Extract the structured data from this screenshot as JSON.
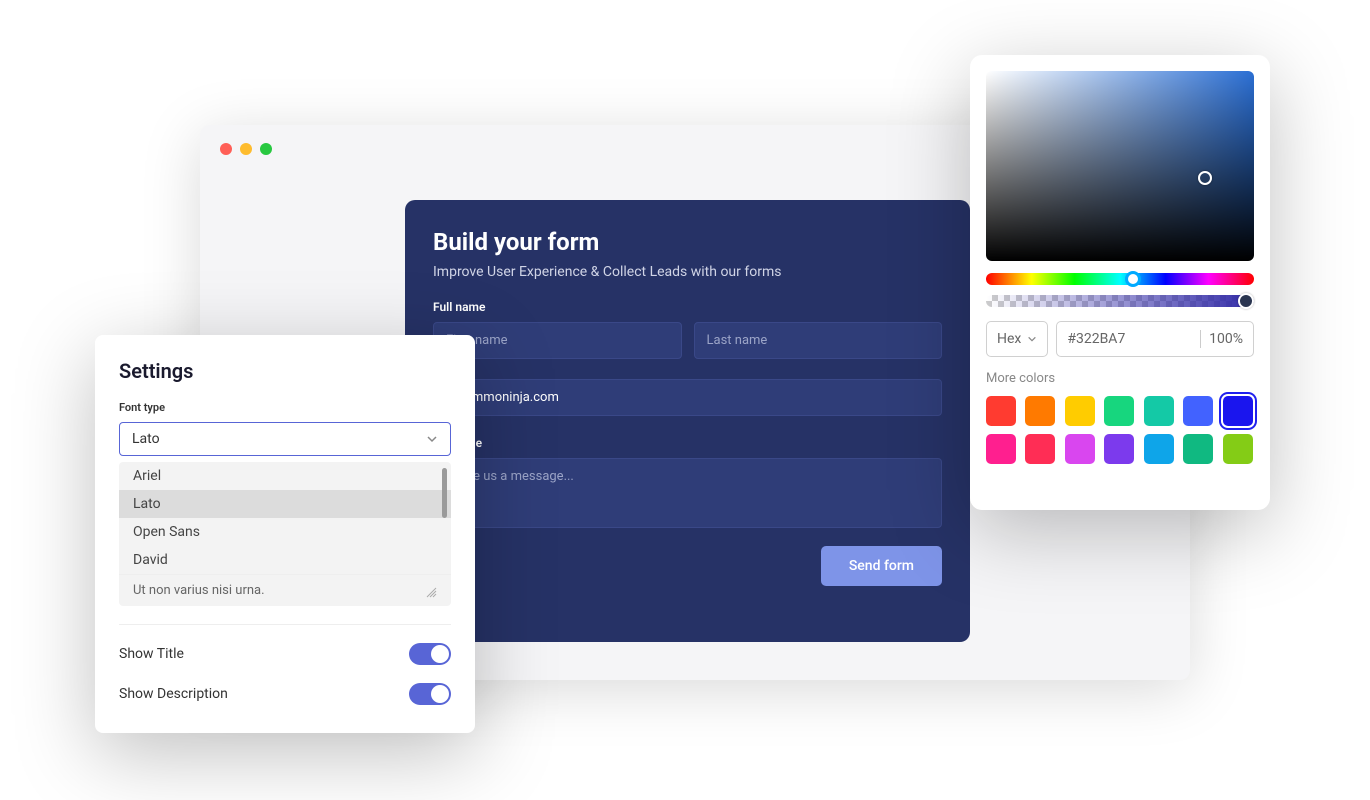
{
  "form": {
    "title": "Build your form",
    "subtitle": "Improve User Experience & Collect Leads with our forms",
    "fullname_label": "Full name",
    "firstname_placeholder": "First name",
    "lastname_placeholder": "Last name",
    "email_value": "@commoninja.com",
    "message_label": "Message",
    "message_placeholder": "Leave us a message...",
    "submit_label": "Send form"
  },
  "settings": {
    "title": "Settings",
    "font_type_label": "Font type",
    "font_selected": "Lato",
    "font_options": [
      "Ariel",
      "Lato",
      "Open Sans",
      "David"
    ],
    "lorem_text": "Ut non varius nisi urna.",
    "show_title_label": "Show Title",
    "show_description_label": "Show Description",
    "show_title_on": true,
    "show_description_on": true
  },
  "color_picker": {
    "format_label": "Hex",
    "hex_value": "#322BA7",
    "opacity": "100%",
    "more_colors_label": "More colors",
    "swatches": [
      "#ff3b30",
      "#ff7a00",
      "#ffcc00",
      "#17d67e",
      "#14c9a6",
      "#4262ff",
      "#1a15ee",
      "#ff1f8f",
      "#ff2d55",
      "#d946ef",
      "#7c3aed",
      "#0ea5e9",
      "#10b981",
      "#84cc16"
    ],
    "selected_swatch_index": 6
  }
}
